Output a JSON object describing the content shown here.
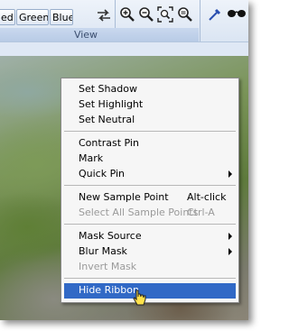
{
  "ribbon": {
    "channel_buttons": {
      "red_partial": "ed",
      "green": "Green",
      "blue": "Blue"
    },
    "group_label": "View"
  },
  "menu": {
    "items": [
      {
        "label": "Set Shadow"
      },
      {
        "label": "Set Highlight"
      },
      {
        "label": "Set Neutral"
      },
      {
        "label": "Contrast Pin"
      },
      {
        "label": "Mark"
      },
      {
        "label": "Quick Pin"
      },
      {
        "label": "New Sample Point",
        "shortcut": "Alt-click"
      },
      {
        "label": "Select All Sample Points",
        "shortcut": "Ctrl-A"
      },
      {
        "label": "Mask Source"
      },
      {
        "label": "Blur Mask"
      },
      {
        "label": "Invert Mask"
      },
      {
        "label": "Hide Ribbon"
      }
    ]
  },
  "icons": {
    "swap": "swap-arrows-icon",
    "zoom_in": "zoom-in-icon",
    "zoom_out": "zoom-out-icon",
    "zoom_fit": "zoom-fit-icon",
    "zoom_actual": "zoom-actual-icon",
    "eyedropper": "eyedropper-icon",
    "glasses": "glasses-icon",
    "cursor": "hand-pointer-icon"
  },
  "colors": {
    "menu_highlight": "#3169c6",
    "menu_background": "#f6f6f6",
    "disabled_text": "#9a9a9a",
    "ribbon_top": "#eef3fa",
    "ribbon_bottom": "#d4e0f0"
  }
}
